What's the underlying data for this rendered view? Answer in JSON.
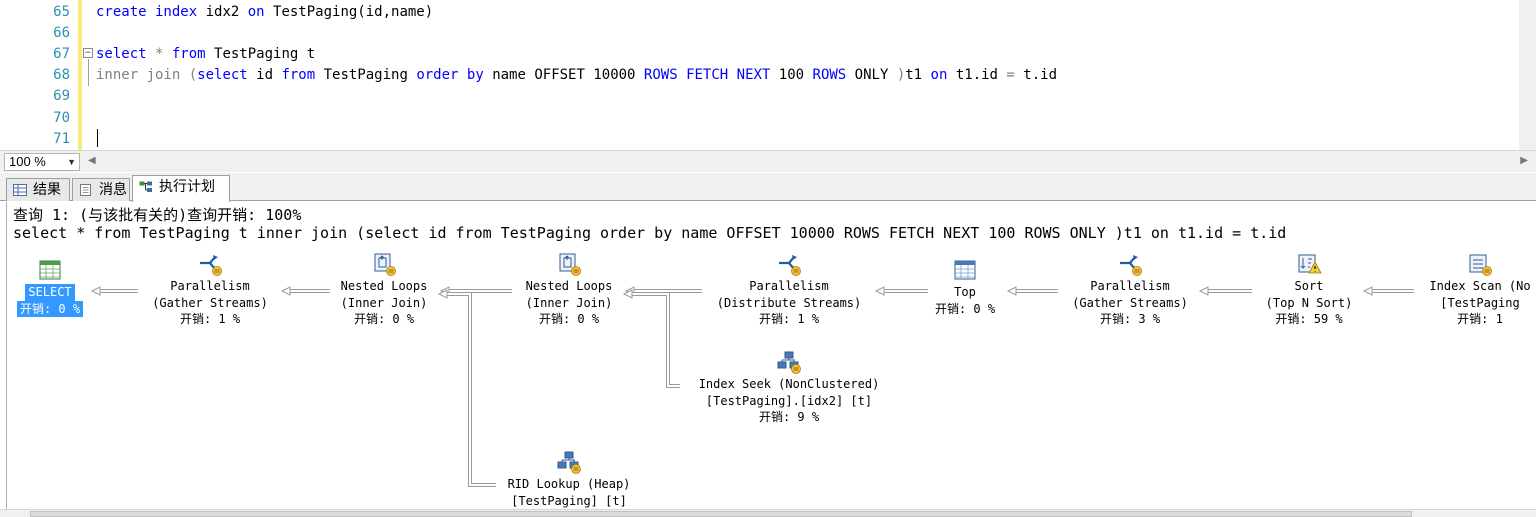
{
  "editor": {
    "line_numbers": [
      "65",
      "66",
      "67",
      "68",
      "69",
      "70",
      "71"
    ],
    "lines": [
      [
        {
          "t": "create index",
          "k": "kw"
        },
        {
          "t": " idx2 ",
          "k": ""
        },
        {
          "t": "on",
          "k": "kw"
        },
        {
          "t": " TestPaging(id,name)",
          "k": ""
        }
      ],
      [],
      [
        {
          "t": "select",
          "k": "kw"
        },
        {
          "t": " * ",
          "k": "gr"
        },
        {
          "t": "from",
          "k": "kw"
        },
        {
          "t": " TestPaging t",
          "k": ""
        }
      ],
      [
        {
          "t": "inner join",
          "k": "gr"
        },
        {
          "t": " (",
          "k": "gr"
        },
        {
          "t": "select",
          "k": "kw"
        },
        {
          "t": " id ",
          "k": ""
        },
        {
          "t": "from",
          "k": "kw"
        },
        {
          "t": " TestPaging ",
          "k": ""
        },
        {
          "t": "order by",
          "k": "kw"
        },
        {
          "t": " name OFFSET 10000 ",
          "k": ""
        },
        {
          "t": "ROWS FETCH NEXT",
          "k": "kw"
        },
        {
          "t": " 100 ",
          "k": ""
        },
        {
          "t": "ROWS",
          "k": "kw"
        },
        {
          "t": " ONLY ",
          "k": ""
        },
        {
          "t": ")",
          "k": "gr"
        },
        {
          "t": "t1 ",
          "k": ""
        },
        {
          "t": "on",
          "k": "kw"
        },
        {
          "t": " t1.id ",
          "k": ""
        },
        {
          "t": "=",
          "k": "gr"
        },
        {
          "t": " t.id",
          "k": ""
        }
      ],
      [],
      [],
      []
    ]
  },
  "zoom": {
    "value": "100 %"
  },
  "tabs": [
    {
      "label": "结果",
      "icon": "grid-icon"
    },
    {
      "label": "消息",
      "icon": "messages-icon"
    },
    {
      "label": "执行计划",
      "icon": "execution-plan-icon"
    }
  ],
  "plan": {
    "header_line1": "查询 1: (与该批有关的)查询开销: 100%",
    "header_line2": "select * from TestPaging t inner join (select id from TestPaging order by name OFFSET 10000 ROWS FETCH NEXT 100 ROWS ONLY )t1 on t1.id = t.id",
    "operators": [
      {
        "id": "select",
        "icon": "select-icon",
        "name": "SELECT",
        "sub": "",
        "cost": "开销: 0 %"
      },
      {
        "id": "par1",
        "icon": "parallelism-icon",
        "name": "Parallelism",
        "sub": "(Gather Streams)",
        "cost": "开销: 1 %"
      },
      {
        "id": "nl1",
        "icon": "nested-loops-icon",
        "name": "Nested Loops",
        "sub": "(Inner Join)",
        "cost": "开销: 0 %"
      },
      {
        "id": "nl2",
        "icon": "nested-loops-icon",
        "name": "Nested Loops",
        "sub": "(Inner Join)",
        "cost": "开销: 0 %"
      },
      {
        "id": "par2",
        "icon": "parallelism-icon",
        "name": "Parallelism",
        "sub": "(Distribute Streams)",
        "cost": "开销: 1 %"
      },
      {
        "id": "top",
        "icon": "top-icon",
        "name": "Top",
        "sub": "",
        "cost": "开销: 0 %"
      },
      {
        "id": "par3",
        "icon": "parallelism-icon",
        "name": "Parallelism",
        "sub": "(Gather Streams)",
        "cost": "开销: 3 %"
      },
      {
        "id": "sort",
        "icon": "sort-warning-icon",
        "name": "Sort",
        "sub": "(Top N Sort)",
        "cost": "开销: 59 %"
      },
      {
        "id": "scan",
        "icon": "index-scan-icon",
        "name": "Index Scan (No",
        "sub": "[TestPaging",
        "cost": "开销: 1"
      },
      {
        "id": "seek",
        "icon": "index-seek-icon",
        "name": "Index Seek (NonClustered)",
        "sub": "[TestPaging].[idx2] [t]",
        "cost": "开销: 9 %"
      },
      {
        "id": "rid",
        "icon": "rid-lookup-icon",
        "name": "RID Lookup (Heap)",
        "sub": "[TestPaging] [t]",
        "cost": ""
      }
    ]
  },
  "colors": {
    "keyword": "#0000ff",
    "gray": "#808080",
    "line_number": "#2b91af",
    "selection": "#3399ff"
  }
}
